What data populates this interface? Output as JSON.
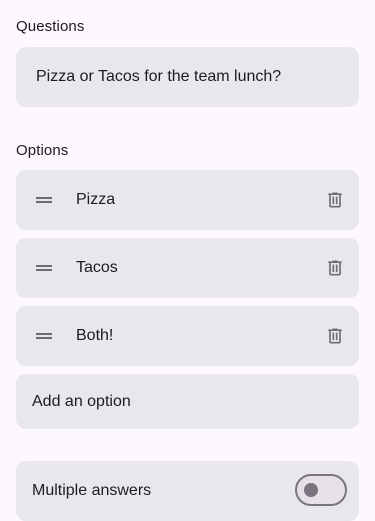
{
  "questions_section": {
    "label": "Questions",
    "question_value": "Pizza or Tacos for the team lunch?"
  },
  "options_section": {
    "label": "Options",
    "items": [
      {
        "label": "Pizza",
        "icon": "delete-icon"
      },
      {
        "label": "Tacos",
        "icon": "delete-icon"
      },
      {
        "label": "Both!",
        "icon": "delete-icon"
      }
    ],
    "add_option_label": "Add an option"
  },
  "settings": {
    "multiple_answers_label": "Multiple answers",
    "multiple_answers_enabled": false
  },
  "colors": {
    "background": "#fdf7fe",
    "field": "#e8e8ec",
    "icon": "#6f6d74",
    "toggle_outline": "#79747e"
  }
}
